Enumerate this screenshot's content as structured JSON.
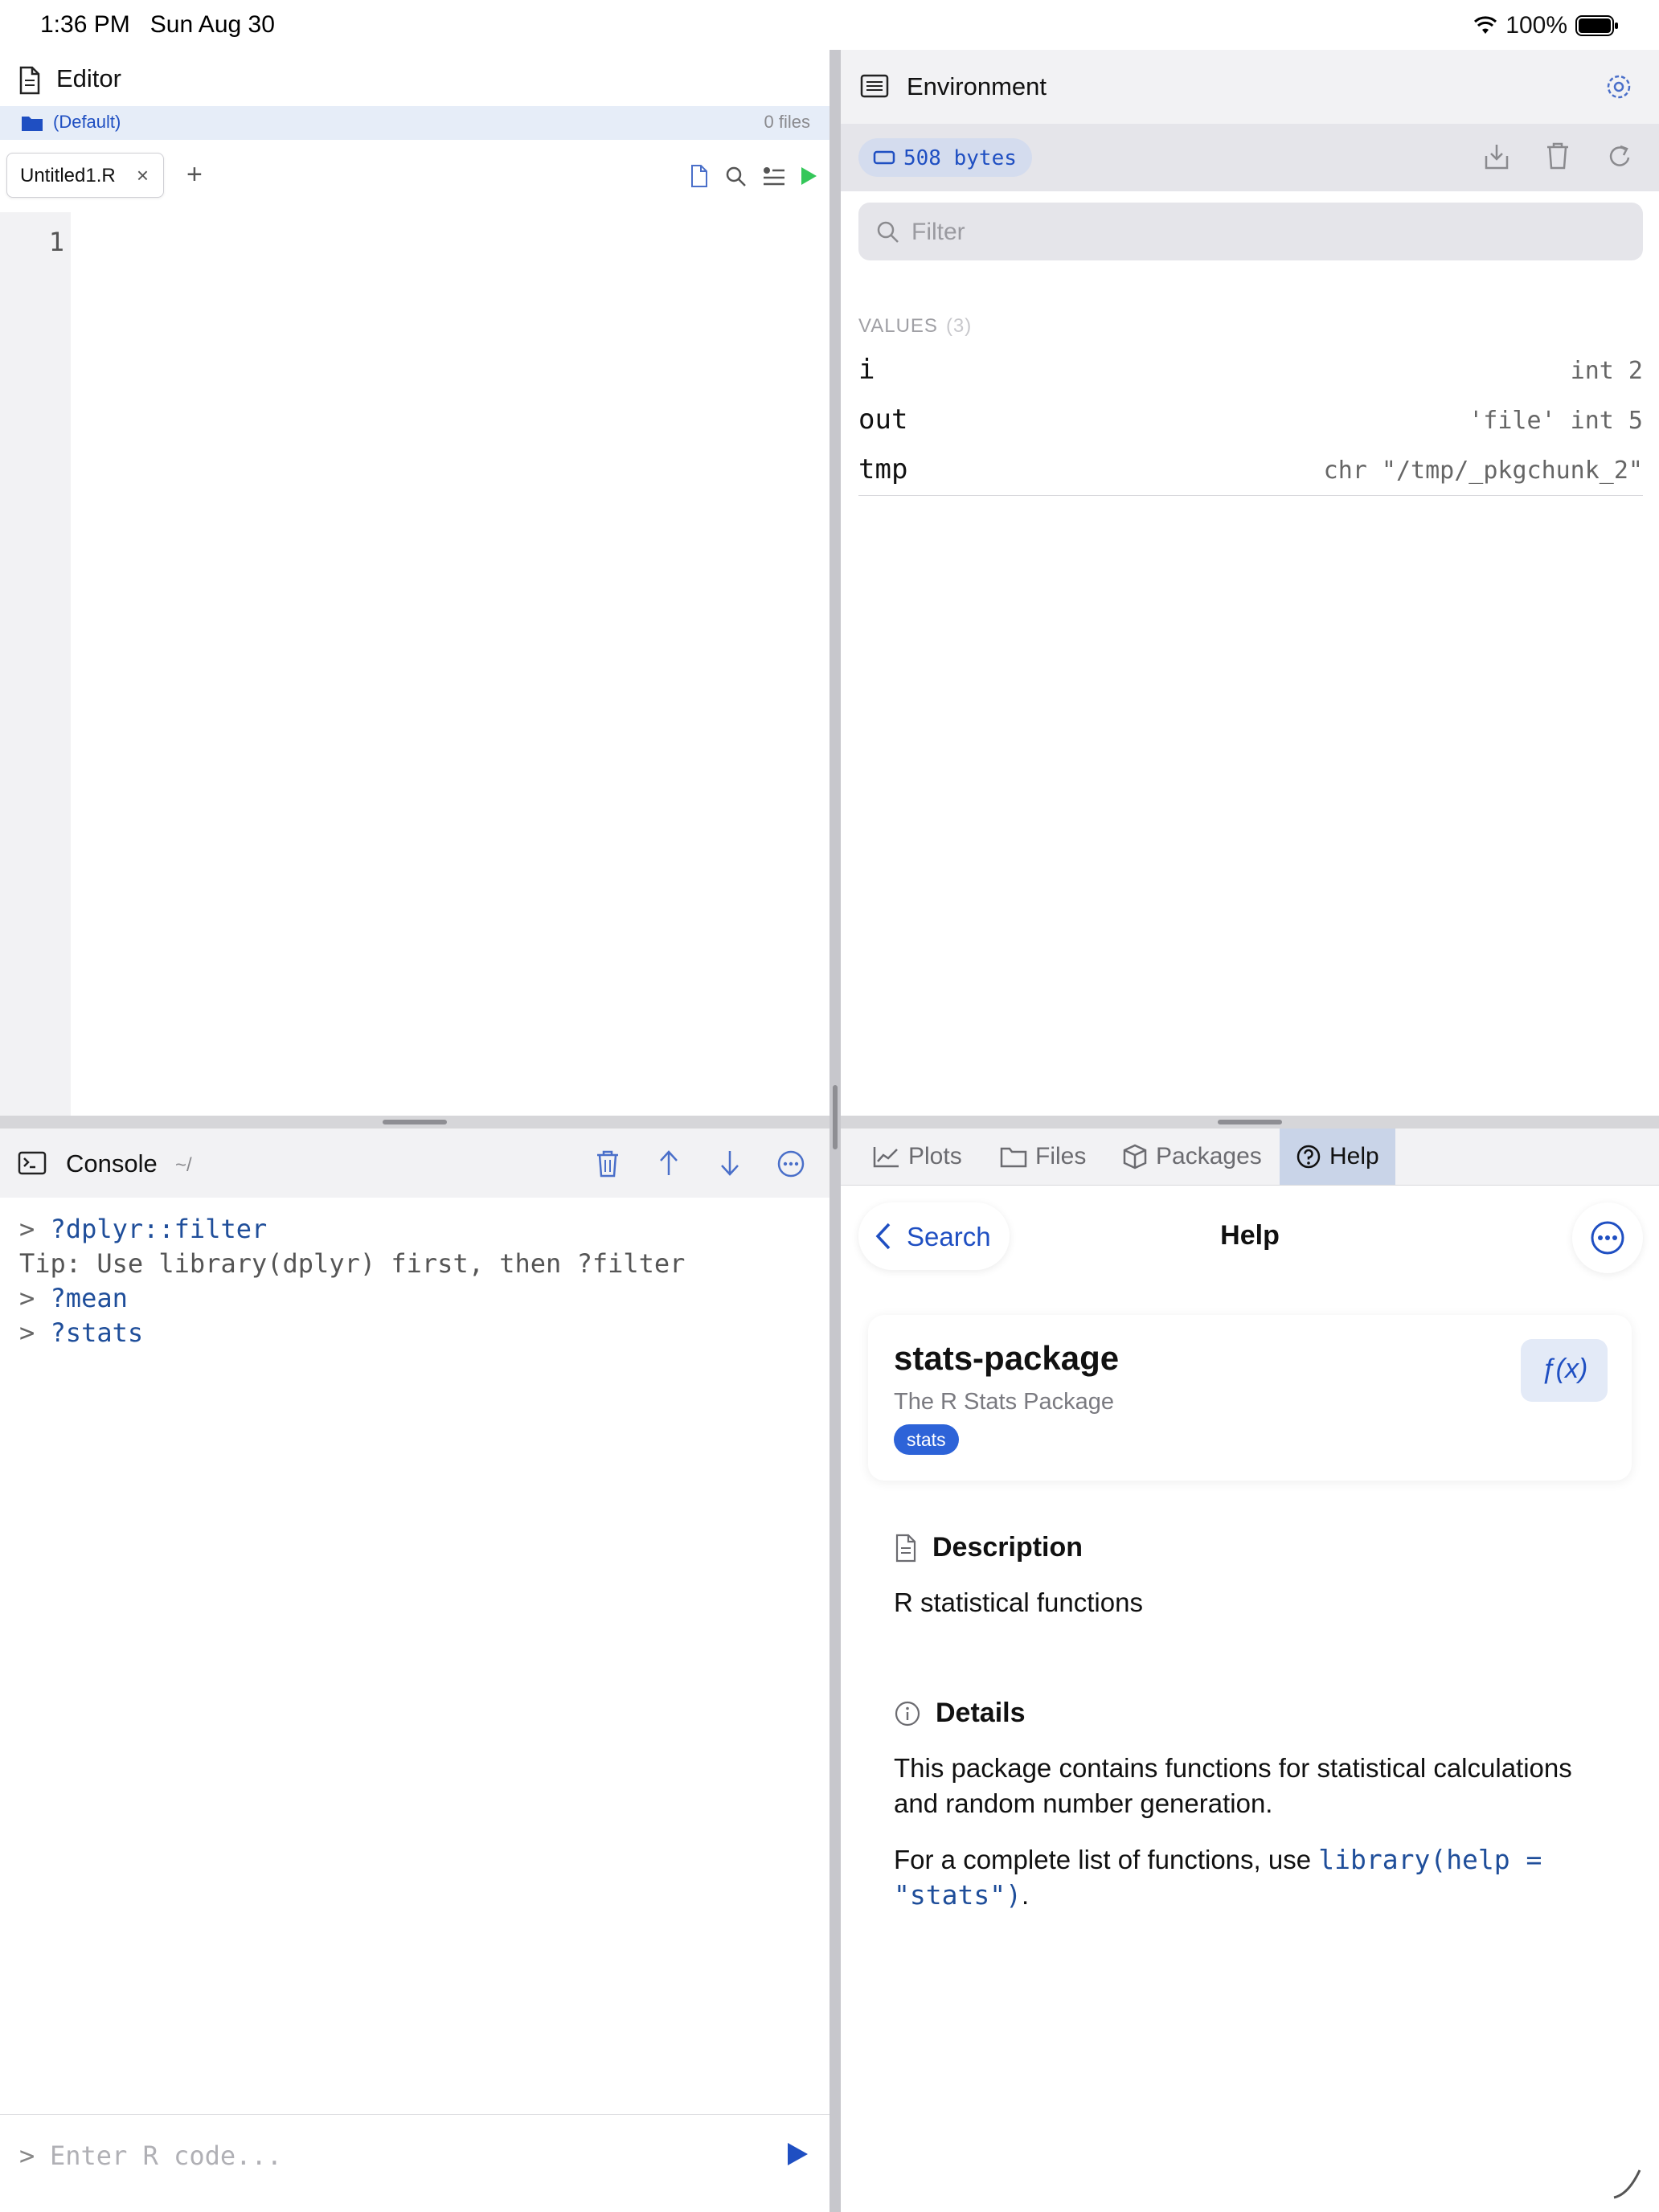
{
  "status_bar": {
    "time": "1:36 PM",
    "date": "Sun Aug 30",
    "battery": "100%"
  },
  "editor": {
    "title": "Editor",
    "project": "(Default)",
    "file_count": "0 files",
    "tab_label": "Untitled1.R",
    "line_numbers": [
      "1"
    ]
  },
  "console": {
    "title": "Console",
    "path": "~/",
    "lines": [
      {
        "prompt": "> ",
        "text": "?dplyr::filter"
      },
      {
        "text": "Tip: Use library(dplyr) first, then ?filter"
      },
      {
        "prompt": "> ",
        "text": "?mean"
      },
      {
        "prompt": "> ",
        "text": "?stats"
      }
    ],
    "input_prompt": ">",
    "input_placeholder": "Enter R code..."
  },
  "environment": {
    "title": "Environment",
    "memory": "508 bytes",
    "filter_placeholder": "Filter",
    "section_label": "VALUES",
    "section_count": "(3)",
    "values": [
      {
        "name": "i",
        "value": "int 2"
      },
      {
        "name": "out",
        "value": "'file' int 5"
      },
      {
        "name": "tmp",
        "value": "chr \"/tmp/_pkgchunk_2\""
      }
    ]
  },
  "pane_tabs": [
    {
      "label": "Plots",
      "icon": "chart-icon"
    },
    {
      "label": "Files",
      "icon": "folder-icon"
    },
    {
      "label": "Packages",
      "icon": "package-icon"
    },
    {
      "label": "Help",
      "icon": "question-icon",
      "active": true
    }
  ],
  "help": {
    "back_label": "Search",
    "title": "Help",
    "package_name": "stats-package",
    "package_subtitle": "The R Stats Package",
    "package_tag": "stats",
    "fx_label": "ƒ(x)",
    "description_heading": "Description",
    "description_text": "R statistical functions",
    "details_heading": "Details",
    "details_line1": "This package contains functions for statistical calculations",
    "details_line2": "and random number generation.",
    "details_p2_prefix": "For a complete list of functions, use ",
    "details_p2_code1": "library(help =",
    "details_p2_code2": "\"stats\")",
    "details_p2_suffix": "."
  },
  "colors": {
    "accent": "#1f4fc2",
    "code": "#1f4e9a",
    "tag": "#2d63d8",
    "run": "#34c759"
  }
}
